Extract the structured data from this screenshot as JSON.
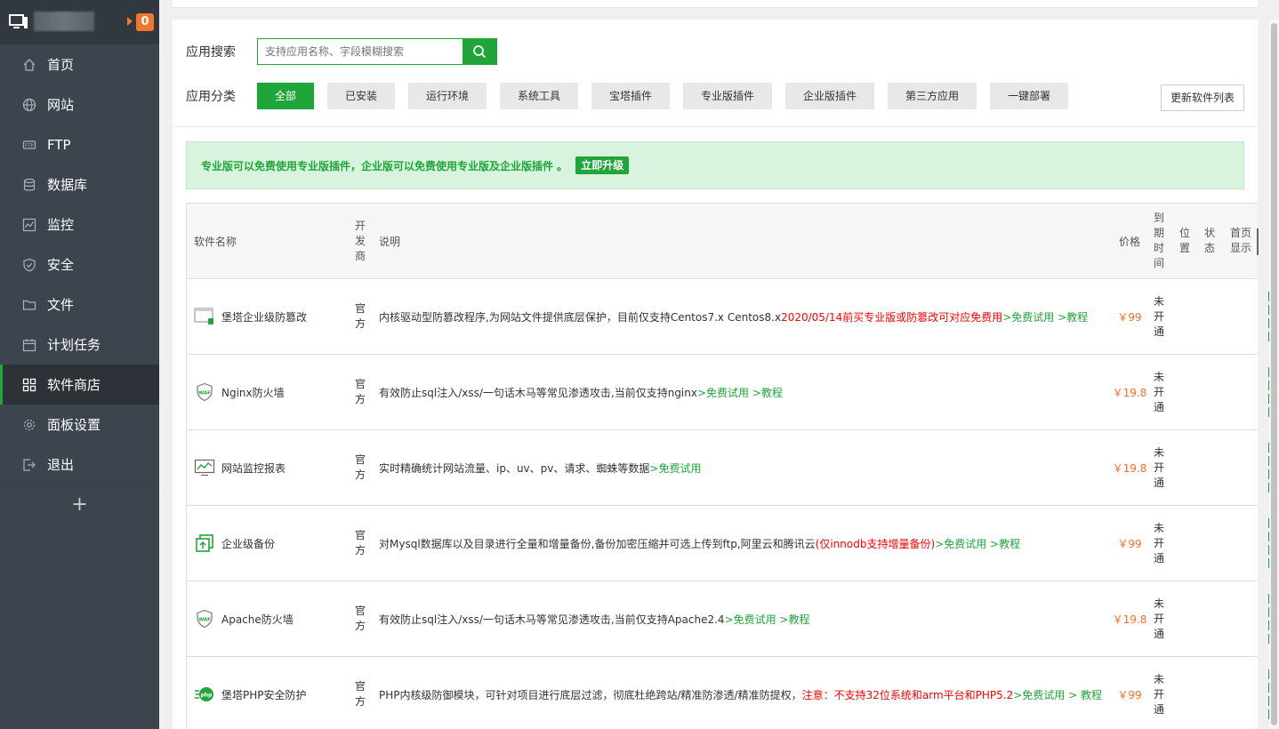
{
  "sidebar": {
    "notification_count": "0",
    "items": [
      {
        "label": "首页",
        "icon": "home-icon"
      },
      {
        "label": "网站",
        "icon": "globe-icon"
      },
      {
        "label": "FTP",
        "icon": "ftp-icon"
      },
      {
        "label": "数据库",
        "icon": "database-icon"
      },
      {
        "label": "监控",
        "icon": "monitor-chart-icon"
      },
      {
        "label": "安全",
        "icon": "shield-icon"
      },
      {
        "label": "文件",
        "icon": "folder-icon"
      },
      {
        "label": "计划任务",
        "icon": "calendar-icon"
      },
      {
        "label": "软件商店",
        "icon": "apps-grid-icon",
        "active": true
      },
      {
        "label": "面板设置",
        "icon": "gear-icon"
      },
      {
        "label": "退出",
        "icon": "logout-icon"
      }
    ],
    "add_label": "+"
  },
  "search": {
    "label": "应用搜索",
    "placeholder": "支持应用名称、字段模糊搜索"
  },
  "categories": {
    "label": "应用分类",
    "items": [
      "全部",
      "已安装",
      "运行环境",
      "系统工具",
      "宝塔插件",
      "专业版插件",
      "企业版插件",
      "第三方应用",
      "一键部署"
    ],
    "active_index": 0
  },
  "update_button": "更新软件列表",
  "notice": {
    "text": "专业版可以免费使用专业版插件，企业版可以免费使用专业版及企业版插件 。",
    "upgrade": "立即升级"
  },
  "table": {
    "headers": {
      "name": "软件名称",
      "developer": [
        "开",
        "发",
        "商"
      ],
      "description": "说明",
      "price": "价格",
      "expire": [
        "到",
        "期",
        "时",
        "间"
      ],
      "position": [
        "位",
        "置"
      ],
      "status": [
        "状",
        "态"
      ],
      "homepage": [
        "首页",
        "显示"
      ]
    },
    "rows": [
      {
        "name": "堡塔企业级防篡改",
        "icon": "tamper-proof-icon",
        "developer": [
          "官",
          "方"
        ],
        "desc": "内核驱动型防篡改程序,为网站文件提供底层保护，目前仅支持Centos7.x Centos8.x ",
        "desc_red": "2020/05/14前买专业版或防篡改可对应免费用",
        "desc_green": " >免费试用 >教程",
        "price": "￥99",
        "expire": [
          "未",
          "开",
          "通"
        ]
      },
      {
        "name": "Nginx防火墙",
        "icon": "waf-shield-icon",
        "developer": [
          "官",
          "方"
        ],
        "desc": "有效防止sql注入/xss/一句话木马等常见渗透攻击,当前仅支持nginx ",
        "desc_red": "",
        "desc_green": ">免费试用 >教程",
        "price": "￥19.8",
        "expire": [
          "未",
          "开",
          "通"
        ]
      },
      {
        "name": "网站监控报表",
        "icon": "monitor-report-icon",
        "developer": [
          "官",
          "方"
        ],
        "desc": "实时精确统计网站流量、ip、uv、pv、请求、蜘蛛等数据 ",
        "desc_red": "",
        "desc_green": ">免费试用",
        "price": "￥19.8",
        "expire": [
          "未",
          "开",
          "通"
        ]
      },
      {
        "name": "企业级备份",
        "icon": "backup-icon",
        "developer": [
          "官",
          "方"
        ],
        "desc": "对Mysql数据库以及目录进行全量和增量备份,备份加密压缩并可选上传到ftp,阿里云和腾讯云",
        "desc_red": "(仅innodb支持增量备份)",
        "desc_green": " >免费试用 >教程",
        "price": "￥99",
        "expire": [
          "未",
          "开",
          "通"
        ]
      },
      {
        "name": "Apache防火墙",
        "icon": "waf-shield-icon",
        "developer": [
          "官",
          "方"
        ],
        "desc": "有效防止sql注入/xss/一句话木马等常见渗透攻击,当前仅支持Apache2.4 ",
        "desc_red": "",
        "desc_green": ">免费试用 >教程",
        "price": "￥19.8",
        "expire": [
          "未",
          "开",
          "通"
        ]
      },
      {
        "name": "堡塔PHP安全防护",
        "icon": "php-security-icon",
        "developer": [
          "官",
          "方"
        ],
        "desc": "PHP内核级防御模块，可针对项目进行底层过滤，彻底杜绝跨站/精准防渗透/精准防提权， ",
        "desc_red": "注意：不支持32位系统和arm平台和PHP5.2",
        "desc_green": " >免费试用 > 教程",
        "price": "￥99",
        "expire": [
          "未",
          "开",
          "通"
        ]
      }
    ]
  }
}
